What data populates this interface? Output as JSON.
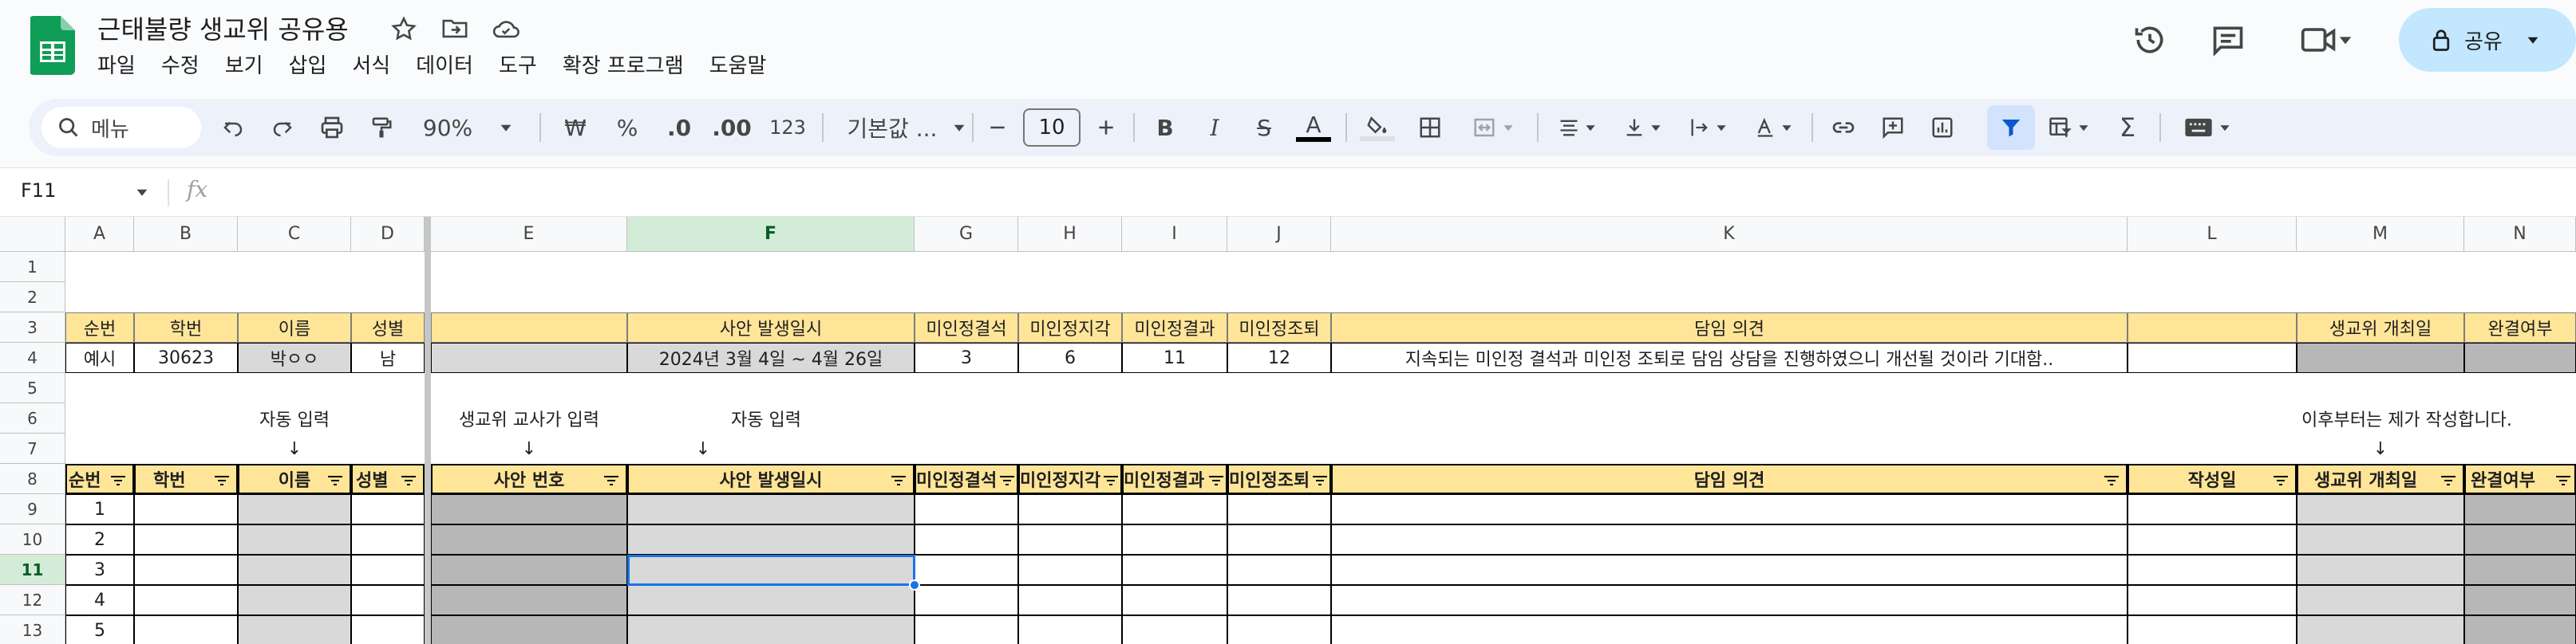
{
  "doc": {
    "title": "근태불량 생교위 공유용"
  },
  "menu": [
    "파일",
    "수정",
    "보기",
    "삽입",
    "서식",
    "데이터",
    "도구",
    "확장 프로그램",
    "도움말"
  ],
  "share": {
    "label": "공유"
  },
  "toolbar": {
    "search_placeholder": "메뉴",
    "zoom": "90%",
    "currency": "₩",
    "percent": "%",
    "dec_decrease": ".0",
    "dec_increase": ".00",
    "number_format": "123",
    "font": "기본값 ...",
    "font_size": "10"
  },
  "formula_bar": {
    "cell_ref": "F11",
    "fx": "fx",
    "content": ""
  },
  "columns": [
    "A",
    "B",
    "C",
    "D",
    "E",
    "F",
    "G",
    "H",
    "I",
    "J",
    "K",
    "L",
    "M",
    "N"
  ],
  "rows": [
    "1",
    "2",
    "3",
    "4",
    "5",
    "6",
    "7",
    "8",
    "9",
    "10",
    "11",
    "12",
    "13"
  ],
  "row3": {
    "a": "순번",
    "b": "학번",
    "c": "이름",
    "d": "성별",
    "f": "사안 발생일시",
    "g": "미인정결석",
    "h": "미인정지각",
    "i": "미인정결과",
    "j": "미인정조퇴",
    "k": "담임 의견",
    "m": "생교위 개최일",
    "n": "완결여부"
  },
  "row4": {
    "a": "예시",
    "b": "30623",
    "c": "박ㅇㅇ",
    "d": "남",
    "f": "2024년 3월 4일 ~ 4월 26일",
    "g": "3",
    "h": "6",
    "i": "11",
    "j": "12",
    "k": "지속되는 미인정 결석과 미인정 조퇴로 담임 상담을 진행하였으니 개선될 것이라 기대함.."
  },
  "row6": {
    "c": "자동 입력",
    "e": "생교위 교사가 입력",
    "f": "자동 입력",
    "m": "이후부터는 제가 작성합니다."
  },
  "arrow": "↓",
  "row8": {
    "a": "순번",
    "b": "학번",
    "c": "이름",
    "d": "성별",
    "e": "사안 번호",
    "f": "사안 발생일시",
    "g": "미인정결석",
    "h": "미인정지각",
    "i": "미인정결과",
    "j": "미인정조퇴",
    "k": "담임 의견",
    "l": "작성일",
    "m": "생교위 개최일",
    "n": "완결여부"
  },
  "data_rows": [
    "1",
    "2",
    "3",
    "4",
    "5"
  ],
  "colors": {
    "header_yellow": "#ffe598",
    "gray": "#d9d9d9",
    "dark_gray": "#b7b7b7",
    "selection": "#1a73e8",
    "share_bg": "#c2e7ff"
  }
}
